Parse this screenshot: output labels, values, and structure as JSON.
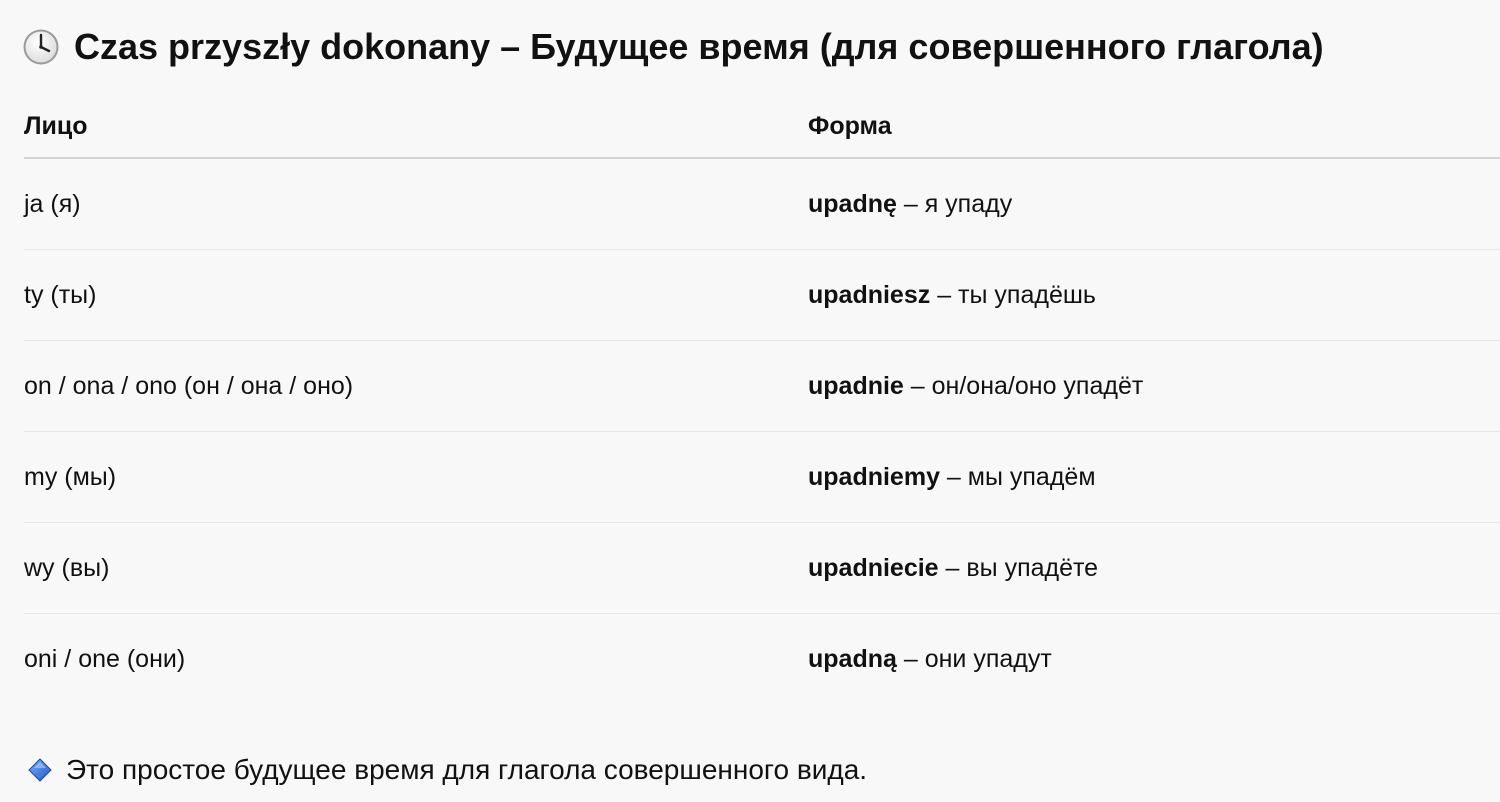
{
  "title": {
    "icon": "clock-icon",
    "text": "Czas przyszły dokonany – Будущее время (для совершенного глагола)"
  },
  "table": {
    "headers": [
      "Лицо",
      "Форма"
    ],
    "rows": [
      {
        "person": "ja (я)",
        "form": "upadnę",
        "translation": " – я упаду"
      },
      {
        "person": "ty (ты)",
        "form": "upadniesz",
        "translation": " – ты упадёшь"
      },
      {
        "person": "on / ona / ono (он / она / оно)",
        "form": "upadnie",
        "translation": " – он/она/оно упадёт"
      },
      {
        "person": "my (мы)",
        "form": "upadniemy",
        "translation": " – мы упадём"
      },
      {
        "person": "wy (вы)",
        "form": "upadniecie",
        "translation": " – вы упадёте"
      },
      {
        "person": "oni / one (они)",
        "form": "upadną",
        "translation": " – они упадут"
      }
    ]
  },
  "note": {
    "icon": "blue-diamond-icon",
    "text": "Это простое будущее время для глагола совершенного вида."
  },
  "colors": {
    "background": "#f8f8f8",
    "text": "#111111",
    "header_rule": "#d4d4d4",
    "row_rule": "#e6e6e6",
    "diamond": "#2f6fd6"
  }
}
